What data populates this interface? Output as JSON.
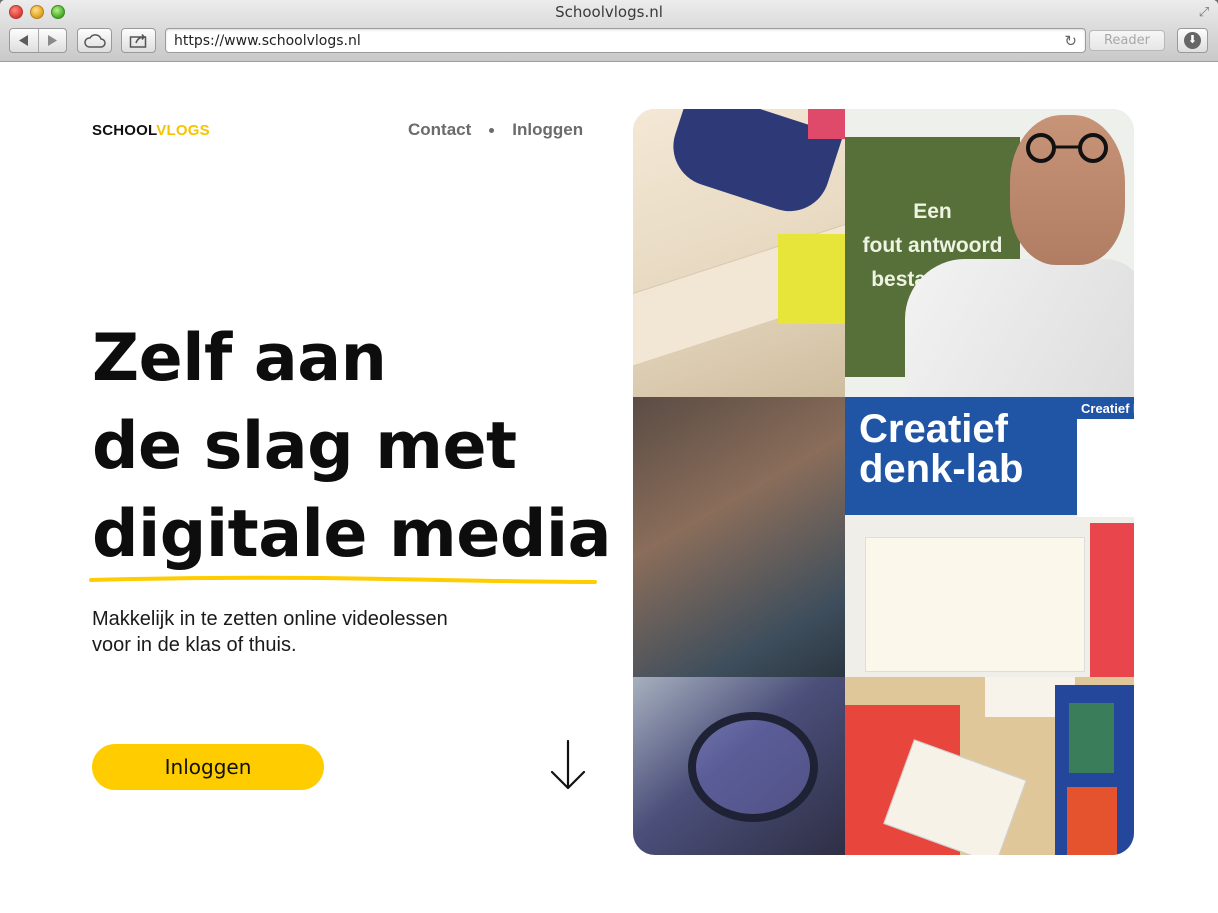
{
  "browser": {
    "window_title": "Schoolvlogs.nl",
    "url": "https://www.schoolvlogs.nl",
    "reader_label": "Reader"
  },
  "logo": {
    "part1": "SCHOOL",
    "part2": "VLOGS"
  },
  "nav": {
    "contact": "Contact",
    "login": "Inloggen"
  },
  "hero": {
    "headline_lines": [
      "Zelf aan",
      "de slag met",
      "digitale media"
    ],
    "subtext_lines": [
      "Makkelijk in te zetten online videolessen",
      "voor in de klas of thuis."
    ],
    "cta_label": "Inloggen",
    "accent_color": "#ffcc00"
  },
  "collage": {
    "poster_green_lines": [
      "Een",
      "fout antwoord",
      "bestaat niet."
    ],
    "poster_blue_lines": [
      "Creatief",
      "denk-lab"
    ],
    "poster_blue_side": "Creatief D"
  },
  "icons": {
    "back": "back-arrow-icon",
    "forward": "forward-arrow-icon",
    "icloud": "cloud-icon",
    "share": "share-icon",
    "reload": "reload-icon",
    "download": "download-icon",
    "scroll": "down-arrow-icon"
  }
}
